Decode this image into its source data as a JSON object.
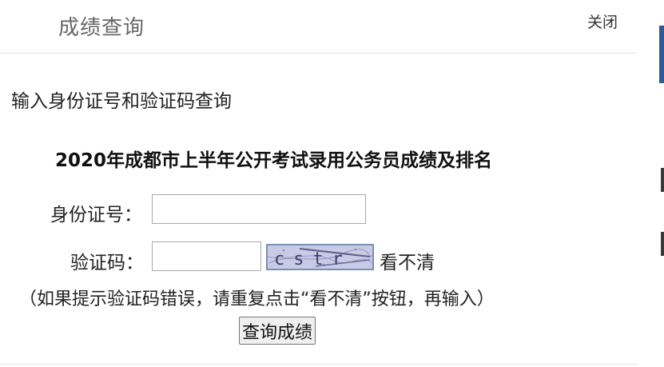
{
  "dialog": {
    "title": "成绩查询",
    "close_label": "关闭"
  },
  "form": {
    "instruction": "输入身份证号和验证码查询",
    "exam_title": "2020年成都市上半年公开考试录用公务员成绩及排名",
    "id_label": "身份证号：",
    "id_value": "",
    "code_label": "验证码：",
    "code_value": "",
    "captcha_text": "cstr",
    "refresh_label": "看不清",
    "hint": "（如果提示验证码错误，请重复点击“看不清”按钮，再输入）",
    "submit_label": "查询成绩"
  },
  "colors": {
    "captcha_bg": "#c9cbe6",
    "title_gray": "#666666",
    "edge_blue": "#2b5c9a"
  }
}
